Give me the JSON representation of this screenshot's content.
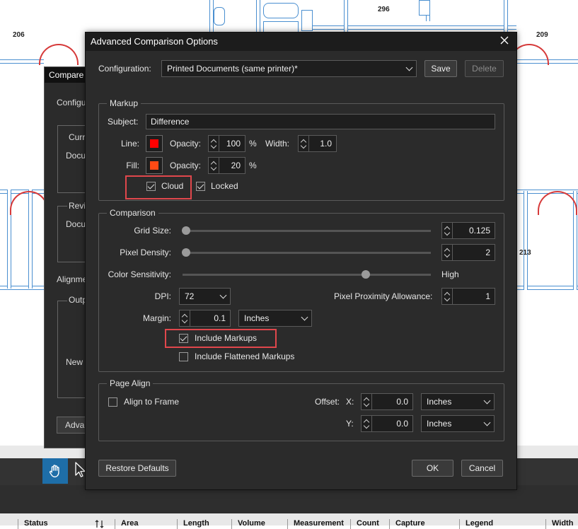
{
  "plan": {
    "room_206": "206",
    "room_296": "296",
    "room_209": "209",
    "room_213": "213"
  },
  "behind_dialog": {
    "title": "Compare",
    "config_label": "Configu",
    "current_label": "Curr",
    "current_doc": "Docu",
    "revised_label": "Revis",
    "revised_doc": "Docu",
    "alignment_label": "Alignme",
    "output_label": "Outp",
    "new_label": "New",
    "advanced_btn": "Adva"
  },
  "dialog": {
    "title": "Advanced Comparison Options",
    "configuration_label": "Configuration:",
    "configuration_value": "Printed Documents (same printer)*",
    "save_label": "Save",
    "delete_label": "Delete",
    "markup": {
      "group_label": "Markup",
      "subject_label": "Subject:",
      "subject_value": "Difference",
      "line_label": "Line:",
      "line_color": "#ff0000",
      "line_opacity_label": "Opacity:",
      "line_opacity_value": "100",
      "line_opacity_unit": "%",
      "width_label": "Width:",
      "width_value": "1.0",
      "fill_label": "Fill:",
      "fill_color": "#ff4a14",
      "fill_opacity_label": "Opacity:",
      "fill_opacity_value": "20",
      "fill_opacity_unit": "%",
      "cloud_label": "Cloud",
      "cloud_checked": true,
      "locked_label": "Locked",
      "locked_checked": true
    },
    "comparison": {
      "group_label": "Comparison",
      "grid_size_label": "Grid Size:",
      "grid_size_value": "0.125",
      "pixel_density_label": "Pixel Density:",
      "pixel_density_value": "2",
      "color_sensitivity_label": "Color Sensitivity:",
      "color_sensitivity_level": "High",
      "dpi_label": "DPI:",
      "dpi_value": "72",
      "pixel_proximity_label": "Pixel Proximity Allowance:",
      "pixel_proximity_value": "1",
      "margin_label": "Margin:",
      "margin_value": "0.1",
      "margin_unit": "Inches",
      "include_markups_label": "Include Markups",
      "include_markups_checked": true,
      "include_flattened_label": "Include Flattened Markups",
      "include_flattened_checked": false
    },
    "page_align": {
      "group_label": "Page Align",
      "align_to_frame_label": "Align to Frame",
      "align_to_frame_checked": false,
      "offset_label": "Offset:",
      "x_label": "X:",
      "x_value": "0.0",
      "x_unit": "Inches",
      "y_label": "Y:",
      "y_value": "0.0",
      "y_unit": "Inches"
    },
    "restore_defaults_label": "Restore Defaults",
    "ok_label": "OK",
    "cancel_label": "Cancel"
  },
  "table_headers": [
    "Status",
    "Area",
    "Length",
    "Volume",
    "Measurement",
    "Count",
    "Capture",
    "Legend",
    "Width"
  ],
  "colors": {
    "highlight": "#e0474c",
    "toolbar_active": "#1e6ea8"
  }
}
